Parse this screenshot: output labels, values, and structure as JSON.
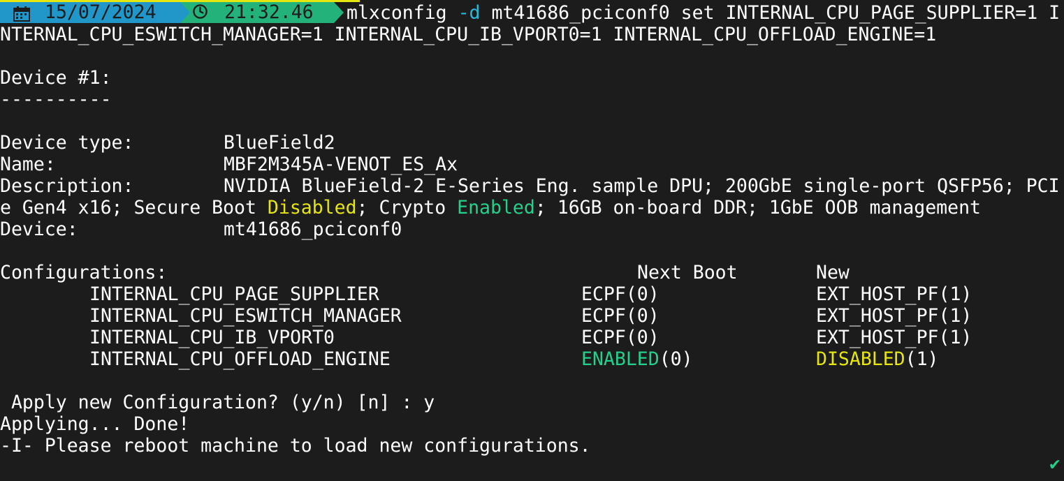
{
  "prompt": {
    "date": "15/07/2024",
    "time": "21:32.46",
    "date_icon": "calendar-icon",
    "time_icon": "clock-icon"
  },
  "command": {
    "program": "mlxconfig",
    "flag": "-d",
    "args_line1": " mt41686_pciconf0 set INTERNAL_CPU_PAGE_SUPPLIER=1 I",
    "args_line2": "NTERNAL_CPU_ESWITCH_MANAGER=1 INTERNAL_CPU_IB_VPORT0=1 INTERNAL_CPU_OFFLOAD_ENGINE=1"
  },
  "device_header": "Device #1:",
  "separator": "----------",
  "info": {
    "type_label": "Device type:",
    "type_value": "BlueField2",
    "name_label": "Name:",
    "name_value": "MBF2M345A-VENOT_ES_Ax",
    "desc_label": "Description:",
    "desc_line1": "NVIDIA BlueField-2 E-Series Eng. sample DPU; 200GbE single-port QSFP56; PCI",
    "desc_line2_a": "e Gen4 x16; Secure Boot ",
    "desc_line2_disabled": "Disabled",
    "desc_line2_b": "; Crypto ",
    "desc_line2_enabled": "Enabled",
    "desc_line2_c": "; 16GB on-board DDR; 1GbE OOB management",
    "device_label": "Device:",
    "device_value": "mt41686_pciconf0"
  },
  "configurations": {
    "label": "Configurations:",
    "col_next_boot": "Next Boot",
    "col_new": "New",
    "rows": [
      {
        "name": "INTERNAL_CPU_PAGE_SUPPLIER",
        "next_word": "",
        "next": "ECPF(0)",
        "new_word": "",
        "new": "EXT_HOST_PF(1)"
      },
      {
        "name": "INTERNAL_CPU_ESWITCH_MANAGER",
        "next_word": "",
        "next": "ECPF(0)",
        "new_word": "",
        "new": "EXT_HOST_PF(1)"
      },
      {
        "name": "INTERNAL_CPU_IB_VPORT0",
        "next_word": "",
        "next": "ECPF(0)",
        "new_word": "",
        "new": "EXT_HOST_PF(1)"
      },
      {
        "name": "INTERNAL_CPU_OFFLOAD_ENGINE",
        "next_word": "ENABLED",
        "next": "(0)",
        "new_word": "DISABLED",
        "new": "(1)"
      }
    ]
  },
  "apply_prompt": " Apply new Configuration? (y/n) [n] : y",
  "applying": "Applying... Done!",
  "reboot_msg": "-I- Please reboot machine to load new configurations.",
  "status_icon": "check-icon",
  "colors": {
    "background": "#1c1c1c",
    "date_segment": "#2196c8",
    "time_segment": "#23b37a",
    "enabled": "#23d18b",
    "disabled": "#e5e510"
  }
}
